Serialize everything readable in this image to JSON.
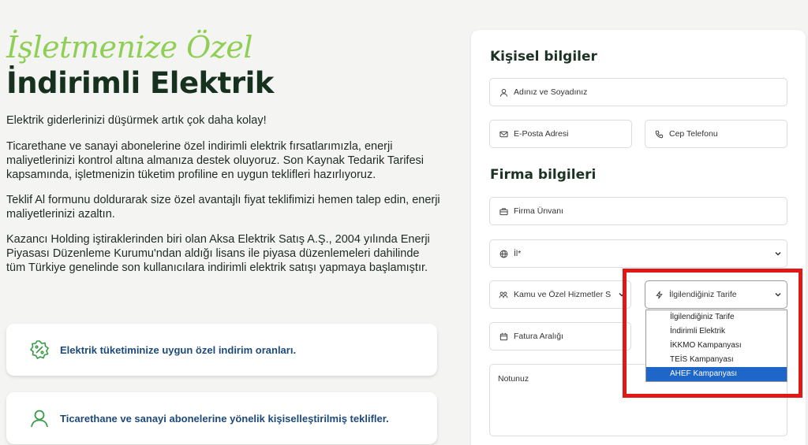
{
  "hero": {
    "accent": "İşletmenize Özel",
    "title": "İndirimli Elektrik"
  },
  "paragraphs": [
    "Elektrik giderlerinizi düşürmek artık çok daha kolay!",
    "Ticarethane ve sanayi abonelerine özel indirimli elektrik fırsatlarımızla, enerji maliyetlerinizi kontrol altına almanıza destek oluyoruz. Son Kaynak Tedarik Tarifesi kapsamında, işletmenizin tüketim profiline en uygun teklifleri hazırlıyoruz.",
    "Teklif Al formunu doldurarak size özel avantajlı fiyat teklifimizi hemen talep edin, enerji maliyetlerinizi azaltın.",
    "Kazancı Holding iştiraklerinden biri olan Aksa Elektrik Satış A.Ş., 2004 yılında Enerji Piyasası Düzenleme Kurumu'ndan aldığı lisans ile piyasa düzenlemeleri dahilinde tüm Türkiye genelinde son kullanıcılara indirimli elektrik satışı yapmaya başlamıştır."
  ],
  "features": [
    {
      "icon": "discount-badge-icon",
      "text": "Elektrik tüketiminize uygun özel indirim oranları."
    },
    {
      "icon": "user-icon",
      "text": "Ticarethane ve sanayi abonelerine yönelik kişiselleştirilmiş teklifler."
    }
  ],
  "form": {
    "personal_title": "Kişisel bilgiler",
    "company_title": "Firma bilgileri",
    "name_placeholder": "Adınız ve Soyadınız",
    "email_placeholder": "E-Posta Adresi",
    "phone_placeholder": "Cep Telefonu",
    "company_placeholder": "Firma Ünvanı",
    "city_value": "İl*",
    "sector_value": "Kamu ve Özel Hizmetler S",
    "tariff_value": "İlgilendiğiniz Tarife",
    "invoice_placeholder": "Fatura Aralığı",
    "notes_placeholder": "Notunuz",
    "tariff_options": [
      "İlgilendiğiniz Tarife",
      "İndirimli Elektrik",
      "İKKMO Kampanyası",
      "TEİS Kampanyası",
      "AHEF Kampanyası"
    ],
    "tariff_selected_index": 4
  },
  "colors": {
    "accent_green": "#8fcf55",
    "title_dark": "#17311f",
    "feature_text": "#1d4a7a",
    "highlight_red": "#e01818",
    "selected_option": "#1e66c7"
  }
}
